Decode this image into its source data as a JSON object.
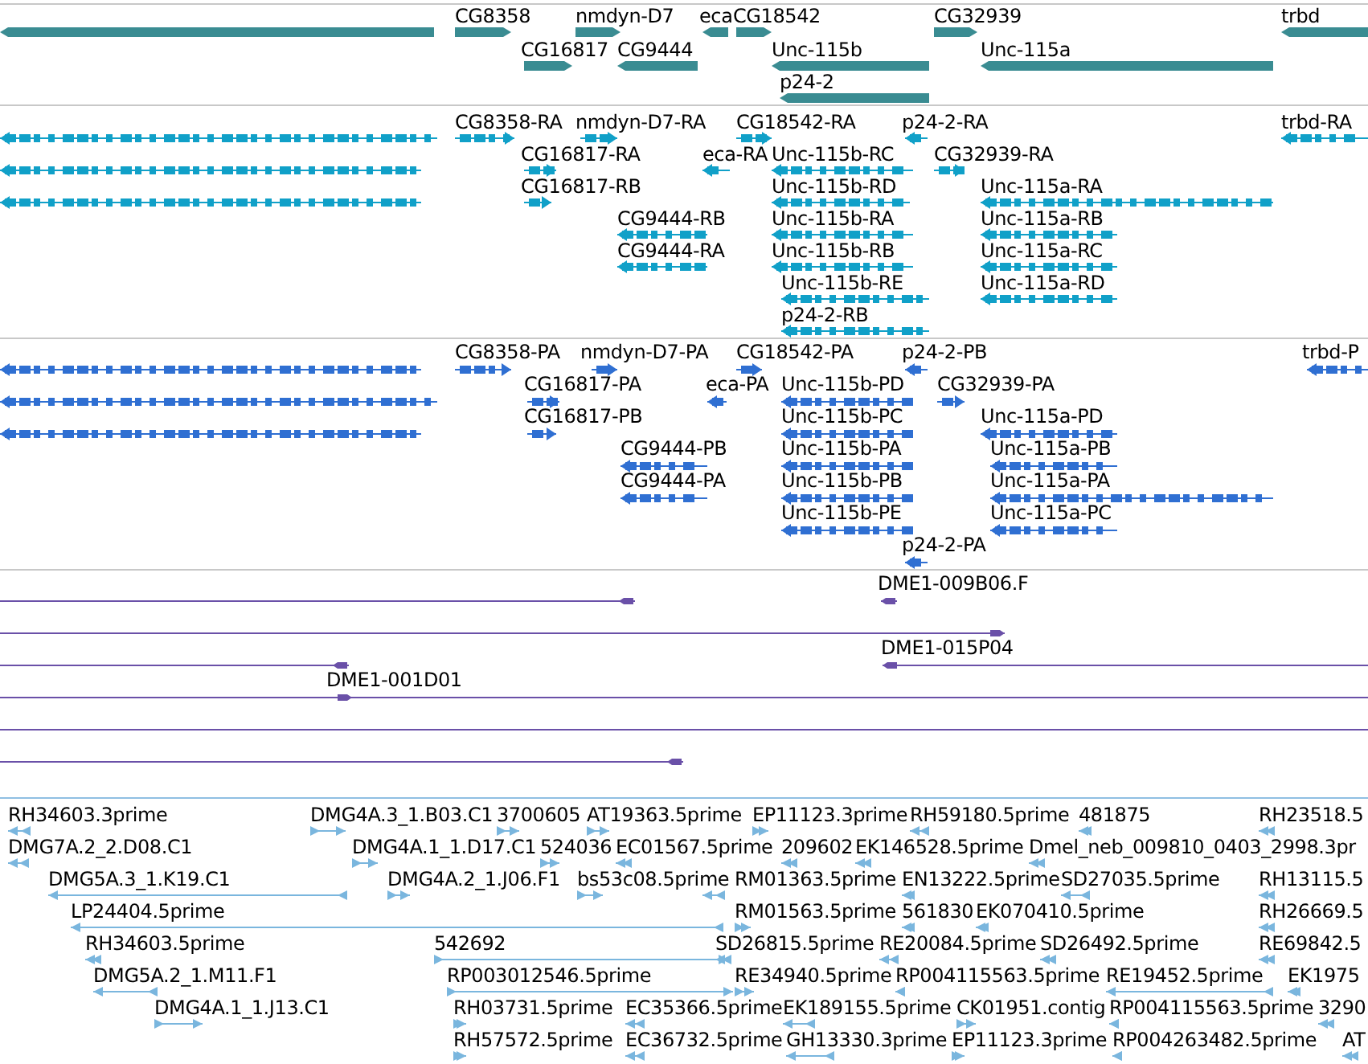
{
  "tracks": [
    {
      "kind": "gene",
      "features": [
        {
          "reverse": true
        },
        {
          "label": "CG8358",
          "reverse": false
        },
        {
          "label": "nmdyn-D7",
          "reverse": false
        },
        {
          "label": "eca",
          "reverse": true
        },
        {
          "label": "CG18542",
          "reverse": false
        },
        {
          "label": "CG32939",
          "reverse": false
        },
        {
          "label": "trbd",
          "reverse": true
        },
        {
          "label": "CG16817",
          "reverse": false
        },
        {
          "label": "CG9444",
          "reverse": true
        },
        {
          "label": "Unc-115b",
          "reverse": true
        },
        {
          "label": "Unc-115a",
          "reverse": true
        },
        {
          "label": "p24-2",
          "reverse": true
        }
      ]
    },
    {
      "kind": "mrna",
      "features": [
        {
          "reverse": true
        },
        {
          "label": "CG8358-RA",
          "reverse": false
        },
        {
          "label": "nmdyn-D7-RA",
          "reverse": false
        },
        {
          "label": "CG18542-RA",
          "reverse": false
        },
        {
          "label": "p24-2-RA",
          "reverse": true
        },
        {
          "label": "trbd-RA",
          "reverse": true
        },
        {
          "reverse": true
        },
        {
          "label": "CG16817-RA",
          "reverse": false
        },
        {
          "label": "eca-RA",
          "reverse": true
        },
        {
          "label": "Unc-115b-RC",
          "reverse": true
        },
        {
          "label": "CG32939-RA",
          "reverse": false
        },
        {
          "reverse": true
        },
        {
          "label": "CG16817-RB",
          "reverse": false
        },
        {
          "label": "Unc-115b-RD",
          "reverse": true
        },
        {
          "label": "Unc-115a-RA",
          "reverse": true
        },
        {
          "label": "CG9444-RB",
          "reverse": true
        },
        {
          "label": "Unc-115b-RA",
          "reverse": true
        },
        {
          "label": "Unc-115a-RB",
          "reverse": true
        },
        {
          "label": "CG9444-RA",
          "reverse": true
        },
        {
          "label": "Unc-115b-RB",
          "reverse": true
        },
        {
          "label": "Unc-115a-RC",
          "reverse": true
        },
        {
          "label": "Unc-115b-RE",
          "reverse": true
        },
        {
          "label": "Unc-115a-RD",
          "reverse": true
        },
        {
          "label": "p24-2-RB",
          "reverse": true
        }
      ]
    },
    {
      "kind": "protein",
      "features": [
        {
          "reverse": true
        },
        {
          "label": "CG8358-PA",
          "reverse": false
        },
        {
          "label": "nmdyn-D7-PA",
          "reverse": false
        },
        {
          "label": "CG18542-PA",
          "reverse": false
        },
        {
          "label": "p24-2-PB",
          "reverse": true
        },
        {
          "label": "trbd-P",
          "reverse": true
        },
        {
          "reverse": true
        },
        {
          "label": "CG16817-PA",
          "reverse": false
        },
        {
          "label": "eca-PA",
          "reverse": true
        },
        {
          "label": "Unc-115b-PD",
          "reverse": true
        },
        {
          "label": "CG32939-PA",
          "reverse": false
        },
        {
          "reverse": true
        },
        {
          "label": "CG16817-PB",
          "reverse": false
        },
        {
          "label": "Unc-115b-PC",
          "reverse": true
        },
        {
          "label": "Unc-115a-PD",
          "reverse": true
        },
        {
          "label": "CG9444-PB",
          "reverse": true
        },
        {
          "label": "Unc-115b-PA",
          "reverse": true
        },
        {
          "label": "Unc-115a-PB",
          "reverse": true
        },
        {
          "label": "CG9444-PA",
          "reverse": true
        },
        {
          "label": "Unc-115b-PB",
          "reverse": true
        },
        {
          "label": "Unc-115a-PA",
          "reverse": true
        },
        {
          "label": "Unc-115b-PE",
          "reverse": true
        },
        {
          "label": "Unc-115a-PC",
          "reverse": true
        },
        {
          "label": "p24-2-PA",
          "reverse": true
        }
      ]
    },
    {
      "kind": "clone",
      "features": [
        {
          "kind": "arrow",
          "reverse": true
        },
        {
          "kind": "arrow",
          "label": "DME1-009B06.F",
          "reverse": true
        },
        {
          "kind": "arrow",
          "reverse": false
        },
        {
          "kind": "arrow",
          "reverse": true
        },
        {
          "kind": "arrow",
          "label": "DME1-015P04",
          "reverse": true
        },
        {
          "kind": "arrow",
          "label": "DME1-001D01",
          "reverse": false
        },
        {
          "kind": "line"
        },
        {
          "kind": "arrow",
          "reverse": true
        }
      ]
    },
    {
      "kind": "est",
      "features": [
        {
          "label": "RH34603.3prime",
          "reverse": true
        },
        {
          "label": "DMG4A.3_1.B03.C1",
          "reverse": false
        },
        {
          "label": "3700605",
          "reverse": false
        },
        {
          "label": "AT19363.5prime",
          "reverse": false
        },
        {
          "label": "EP11123.3prime",
          "reverse": false
        },
        {
          "label": "RH59180.5prime",
          "reverse": true
        },
        {
          "label": "481875",
          "reverse": true
        },
        {
          "label": "RH23518.5",
          "reverse": true
        },
        {
          "label": "DMG7A.2_2.D08.C1",
          "reverse": true
        },
        {
          "label": "DMG4A.1_1.D17.C1",
          "reverse": false
        },
        {
          "label": "524036",
          "reverse": false
        },
        {
          "label": "EC01567.5prime",
          "reverse": true
        },
        {
          "label": "209602",
          "reverse": true
        },
        {
          "label": "EK146528.5prime",
          "reverse": true
        },
        {
          "label": "Dmel_neb_009810_0403_2998.3pr",
          "reverse": true
        },
        {
          "label": "DMG5A.3_1.K19.C1",
          "reverse": true
        },
        {
          "label": "DMG4A.2_1.J06.F1",
          "reverse": false
        },
        {
          "label": "bs53c08.5prime",
          "reverse": false
        },
        {
          "label": "RM01363.5prime",
          "reverse": true
        },
        {
          "label": "EN13222.5prime",
          "reverse": true
        },
        {
          "label": "SD27035.5prime",
          "reverse": true
        },
        {
          "label": "RH13115.5",
          "reverse": true
        },
        {
          "label": "LP24404.5prime",
          "reverse": true
        },
        {
          "label": "RM01563.5prime",
          "reverse": false
        },
        {
          "label": "561830",
          "reverse": true
        },
        {
          "label": "EK070410.5prime",
          "reverse": true
        },
        {
          "label": "RH26669.5",
          "reverse": true
        },
        {
          "label": "RH34603.5prime",
          "reverse": true
        },
        {
          "label": "542692",
          "reverse": false
        },
        {
          "label": "SD26815.5prime",
          "reverse": true
        },
        {
          "label": "RE20084.5prime",
          "reverse": true
        },
        {
          "label": "SD26492.5prime",
          "reverse": true
        },
        {
          "label": "RE69842.5",
          "reverse": true
        },
        {
          "label": "DMG5A.2_1.M11.F1",
          "reverse": true
        },
        {
          "label": "RP003012546.5prime",
          "reverse": false
        },
        {
          "label": "RE34940.5prime",
          "reverse": false
        },
        {
          "label": "RP004115563.5prime",
          "reverse": true
        },
        {
          "label": "RE19452.5prime",
          "reverse": true
        },
        {
          "label": "EK1975",
          "reverse": true
        },
        {
          "label": "DMG4A.1_1.J13.C1",
          "reverse": false
        },
        {
          "label": "RH03731.5prime",
          "reverse": false
        },
        {
          "label": "EC35366.5prime",
          "reverse": true
        },
        {
          "label": "EK189155.5prime",
          "reverse": true
        },
        {
          "label": "CK01951.contig",
          "reverse": false
        },
        {
          "label": "RP004115563.5prime",
          "reverse": true
        },
        {
          "label": "3290",
          "reverse": true
        },
        {
          "label": "RH57572.5prime",
          "reverse": false
        },
        {
          "label": "EC36732.5prime",
          "reverse": true
        },
        {
          "label": "GH13330.3prime",
          "reverse": true
        },
        {
          "label": "EP11123.3prime",
          "reverse": false
        },
        {
          "label": "RP004263482.5prime",
          "reverse": true
        },
        {
          "label": "AT",
          "reverse": true
        }
      ]
    }
  ]
}
